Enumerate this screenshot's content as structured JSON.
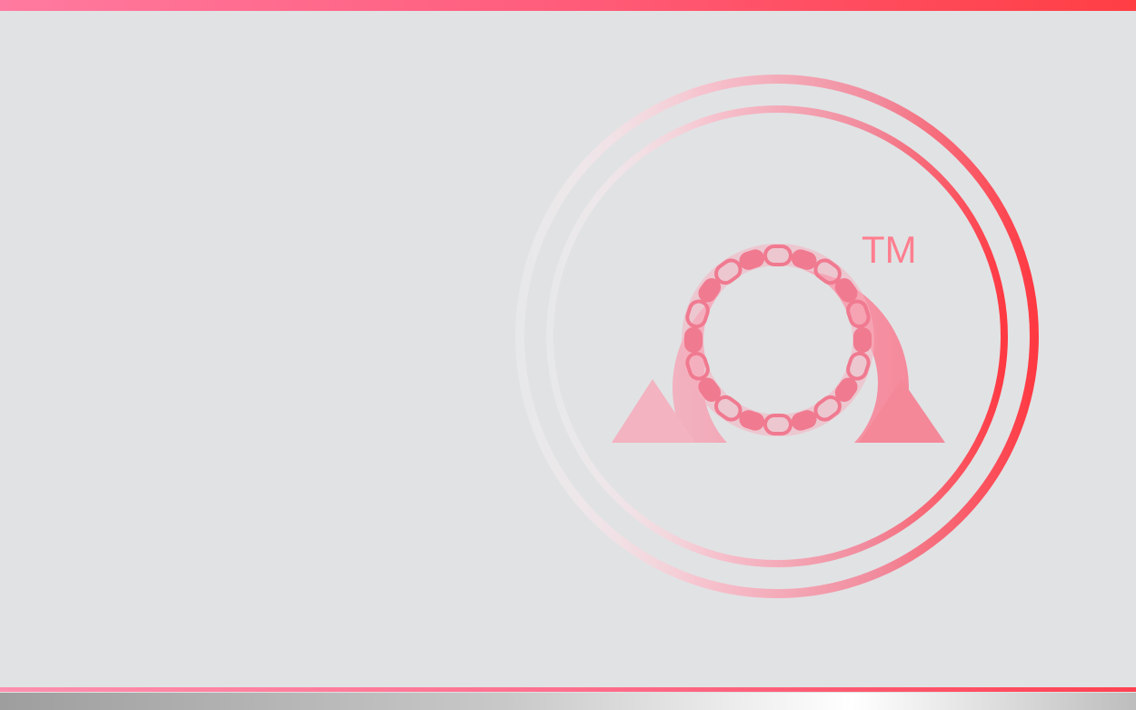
{
  "logo": {
    "name": "omega-chain-ring-logo",
    "trademark": "TM"
  },
  "colors": {
    "background": "#e1e2e4",
    "accent_start": "#ff7aa0",
    "accent_end": "#ff3e44",
    "logo_light": "#f7c0cc",
    "logo_mid": "#f08a9e",
    "logo_strong": "#ff3e46"
  }
}
